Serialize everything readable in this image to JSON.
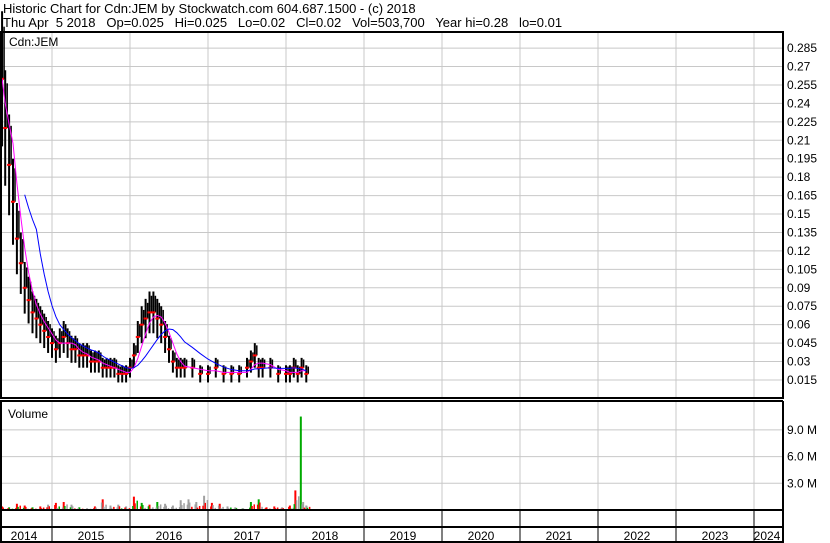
{
  "header": {
    "line1": "Historic Chart for Cdn:JEM by Stockwatch.com 604.687.1500 - (c) 2018",
    "line2": "Thu Apr  5 2018   Op=0.025   Hi=0.025   Lo=0.02   Cl=0.02   Vol=503,700   Year hi=0.28   lo=0.01"
  },
  "chart_data": [
    {
      "type": "line",
      "title": "Cdn:JEM",
      "ylim": [
        0,
        0.297
      ],
      "yticks": [
        "0.285",
        "0.27",
        "0.255",
        "0.24",
        "0.225",
        "0.21",
        "0.195",
        "0.18",
        "0.165",
        "0.15",
        "0.135",
        "0.12",
        "0.105",
        "0.09",
        "0.075",
        "0.06",
        "0.045",
        "0.03",
        "0.015"
      ],
      "xticks": [
        "2014",
        "2015",
        "2016",
        "2017",
        "2018",
        "2019",
        "2020",
        "2021",
        "2022",
        "2023",
        "2024"
      ],
      "x": [
        2014.36,
        2014.4,
        2014.45,
        2014.5,
        2014.55,
        2014.6,
        2014.65,
        2014.7,
        2014.75,
        2014.8,
        2014.85,
        2014.9,
        2014.95,
        2015.0,
        2015.05,
        2015.1,
        2015.15,
        2015.2,
        2015.25,
        2015.3,
        2015.35,
        2015.4,
        2015.45,
        2015.5,
        2015.55,
        2015.6,
        2015.65,
        2015.7,
        2015.75,
        2015.8,
        2015.85,
        2015.9,
        2015.95,
        2016.0,
        2016.05,
        2016.1,
        2016.15,
        2016.2,
        2016.25,
        2016.3,
        2016.35,
        2016.4,
        2016.45,
        2016.5,
        2016.55,
        2016.6,
        2016.65,
        2016.7,
        2016.8,
        2016.9,
        2017.0,
        2017.1,
        2017.2,
        2017.3,
        2017.4,
        2017.5,
        2017.55,
        2017.6,
        2017.65,
        2017.7,
        2017.8,
        2017.9,
        2018.0,
        2018.05,
        2018.1,
        2018.15,
        2018.2,
        2018.26
      ],
      "series": [
        {
          "name": "close",
          "color": "#000000",
          "values": [
            0.26,
            0.22,
            0.19,
            0.16,
            0.13,
            0.11,
            0.09,
            0.08,
            0.07,
            0.065,
            0.06,
            0.055,
            0.05,
            0.045,
            0.04,
            0.045,
            0.05,
            0.045,
            0.04,
            0.04,
            0.035,
            0.035,
            0.035,
            0.03,
            0.03,
            0.03,
            0.025,
            0.025,
            0.025,
            0.025,
            0.02,
            0.02,
            0.02,
            0.025,
            0.035,
            0.05,
            0.06,
            0.065,
            0.07,
            0.07,
            0.065,
            0.06,
            0.05,
            0.04,
            0.03,
            0.025,
            0.025,
            0.025,
            0.025,
            0.02,
            0.02,
            0.025,
            0.02,
            0.02,
            0.02,
            0.025,
            0.03,
            0.035,
            0.025,
            0.025,
            0.025,
            0.02,
            0.02,
            0.02,
            0.025,
            0.02,
            0.025,
            0.02
          ]
        },
        {
          "name": "short moving average",
          "color": "#ff00ff"
        },
        {
          "name": "long moving average",
          "color": "#0000ff"
        }
      ]
    },
    {
      "type": "bar",
      "title": "Volume",
      "ylim": [
        0,
        11000000
      ],
      "yticks": [
        "9.0 M",
        "6.0 M",
        "3.0 M"
      ],
      "x": [
        2014.36,
        2014.45,
        2014.55,
        2014.65,
        2014.75,
        2014.85,
        2014.95,
        2015.05,
        2015.15,
        2015.25,
        2015.35,
        2015.45,
        2015.55,
        2015.65,
        2015.75,
        2015.85,
        2015.95,
        2016.05,
        2016.15,
        2016.25,
        2016.35,
        2016.45,
        2016.55,
        2016.65,
        2016.75,
        2016.85,
        2016.95,
        2017.05,
        2017.15,
        2017.25,
        2017.35,
        2017.45,
        2017.55,
        2017.65,
        2017.75,
        2017.85,
        2017.95,
        2018.05,
        2018.12,
        2018.19,
        2018.22,
        2018.26
      ],
      "values": [
        400000,
        300000,
        700000,
        500000,
        300000,
        400000,
        600000,
        800000,
        900000,
        600000,
        300000,
        200000,
        400000,
        1200000,
        500000,
        600000,
        400000,
        1500000,
        800000,
        600000,
        900000,
        700000,
        500000,
        1100000,
        1200000,
        900000,
        1600000,
        800000,
        700000,
        400000,
        300000,
        200000,
        900000,
        1200000,
        300000,
        400000,
        300000,
        500000,
        2200000,
        10500000,
        900000,
        503700
      ],
      "colors": [
        "#ff0000",
        "#00aa00",
        "#ff0000",
        "#ff0000",
        "#00aa00",
        "#ff0000",
        "#a0a0a0",
        "#ff0000",
        "#ff0000",
        "#a0a0a0",
        "#00aa00",
        "#a0a0a0",
        "#ff0000",
        "#ff0000",
        "#a0a0a0",
        "#a0a0a0",
        "#a0a0a0",
        "#ff0000",
        "#00aa00",
        "#ff0000",
        "#00aa00",
        "#a0a0a0",
        "#a0a0a0",
        "#a0a0a0",
        "#a0a0a0",
        "#a0a0a0",
        "#a0a0a0",
        "#ff0000",
        "#ff0000",
        "#a0a0a0",
        "#a0a0a0",
        "#a0a0a0",
        "#00aa00",
        "#00aa00",
        "#ff0000",
        "#ff0000",
        "#a0a0a0",
        "#ff0000",
        "#ff0000",
        "#00aa00",
        "#a0a0a0",
        "#a0a0a0"
      ]
    }
  ]
}
